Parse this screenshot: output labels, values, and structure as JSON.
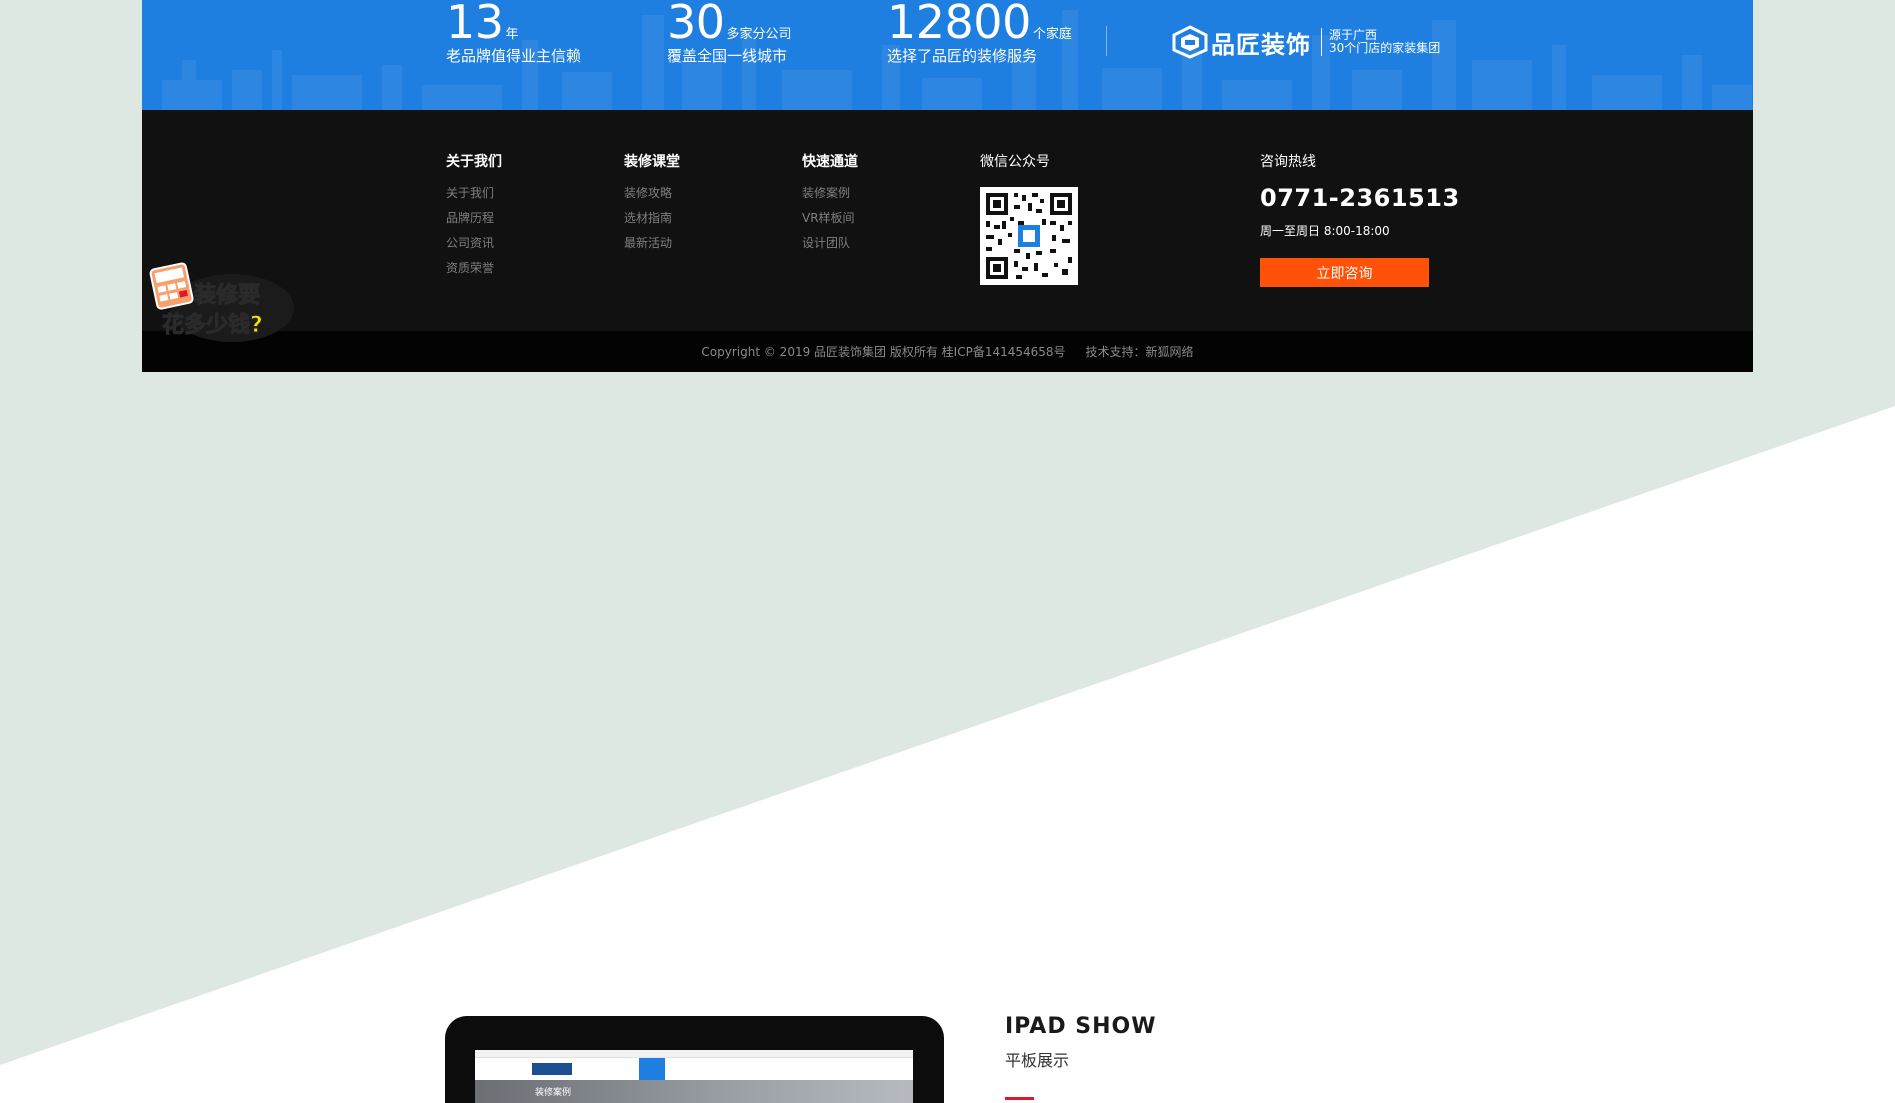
{
  "stats": [
    {
      "number": "13",
      "unit": "年",
      "desc": "老品牌值得业主信赖"
    },
    {
      "number": "30",
      "unit": "多家分公司",
      "desc": "覆盖全国一线城市"
    },
    {
      "number": "12800",
      "unit": "个家庭",
      "desc": "选择了品匠的装修服务"
    }
  ],
  "brand": {
    "logo_icon": "pinjiang-logo-icon",
    "name": "品匠装饰",
    "tagline_line1": "源于广西",
    "tagline_line2": "30个门店的家装集团"
  },
  "footer": {
    "columns": [
      {
        "title": "关于我们",
        "links": [
          "关于我们",
          "品牌历程",
          "公司资讯",
          "资质荣誉"
        ]
      },
      {
        "title": "装修课堂",
        "links": [
          "装修攻略",
          "选材指南",
          "最新活动"
        ]
      },
      {
        "title": "快速通道",
        "links": [
          "装修案例",
          "VR样板间",
          "设计团队"
        ]
      }
    ],
    "wechat_title": "微信公众号",
    "qr_icon": "qr-code-icon",
    "hotline_title": "咨询热线",
    "hotline_number": "0771-2361513",
    "hotline_hours": "周一至周日 8:00-18:00",
    "consult_button": "立即咨询"
  },
  "copyright": {
    "text": "Copyright © 2019 品匠装饰集团 版权所有 桂ICP备141454658号",
    "tech_support": "技术支持：新狐网络"
  },
  "float_badge": {
    "line1": "装修要",
    "line2": "花多少钱?"
  },
  "ipad_show": {
    "title": "IPAD SHOW",
    "subtitle": "平板展示",
    "screen_heading": "装修案例"
  },
  "colors": {
    "band_blue": "#1e7fe0",
    "footer_black": "#121112",
    "accent_orange": "#ff5208",
    "accent_red": "#e0162b",
    "diagonal_gray": "#dee8e3"
  }
}
